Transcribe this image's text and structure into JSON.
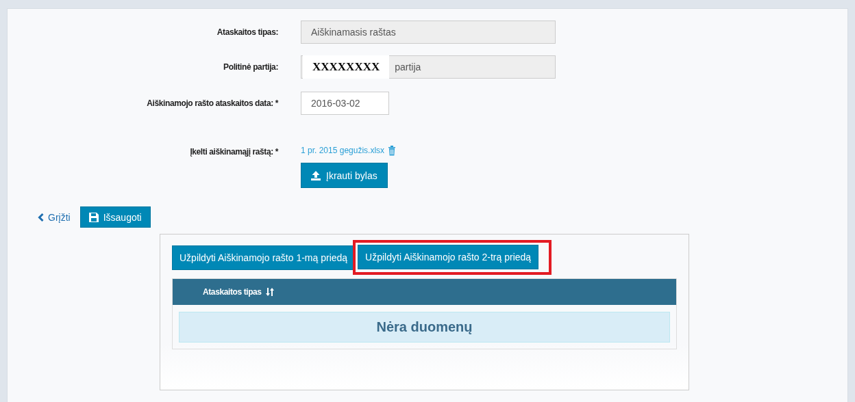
{
  "form": {
    "fields": [
      {
        "kind": "readonly",
        "label": "Ataskaitos tipas:",
        "value": "Aiškinamasis raštas"
      },
      {
        "kind": "party",
        "label": "Politinė partija:",
        "redacted": "XXXXXXXX",
        "value": "partija"
      },
      {
        "kind": "date",
        "label": "Aiškinamojo rašto ataskaitos data: *",
        "value": "2016-03-02"
      },
      {
        "kind": "file",
        "label": "Įkelti aiškinamąjį raštą: *",
        "file": "1 pr. 2015 gegužis.xlsx",
        "button": "Įkrauti bylas"
      }
    ]
  },
  "actions": {
    "back": "Grįžti",
    "save": "Išsaugoti"
  },
  "tabs": [
    {
      "label": "Užpildyti Aiškinamojo rašto 1-mą priedą",
      "highlighted": false
    },
    {
      "label": "Užpildyti Aiškinamojo rašto 2-trą priedą",
      "highlighted": true
    }
  ],
  "table": {
    "columns": [
      "Ataskaitos tipas"
    ],
    "empty_message": "Nėra duomenų"
  }
}
